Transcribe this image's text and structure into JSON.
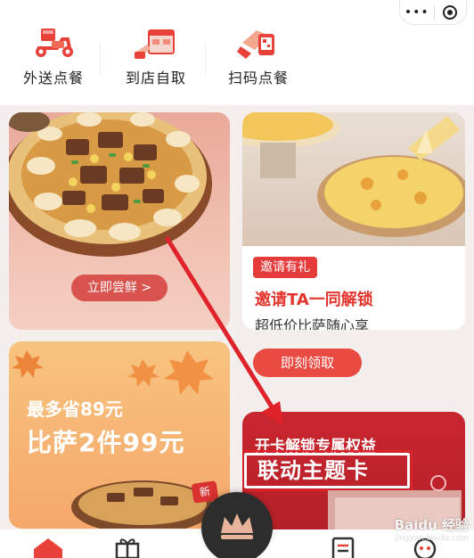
{
  "capsule": {
    "more_icon": "ellipsis-icon",
    "close_icon": "target-icon"
  },
  "services": [
    {
      "label": "外送点餐",
      "icon": "delivery-scooter-icon"
    },
    {
      "label": "到店自取",
      "icon": "store-pickup-icon"
    },
    {
      "label": "扫码点餐",
      "icon": "scan-order-icon"
    }
  ],
  "card_a": {
    "button": "立即尝鲜 >"
  },
  "card_b": {
    "tag": "邀请有礼",
    "title": "邀请TA一同解锁",
    "subtitle": "超低价比萨随心享",
    "button": "即刻领取"
  },
  "card_c": {
    "line1": "最多省89元",
    "line2": "比萨2件99元",
    "badge": "新"
  },
  "card_d": {
    "headline": "开卡解锁专属权益",
    "big": "联动主题卡"
  },
  "tabs": [
    "home-icon",
    "gift-icon",
    "crown-icon",
    "order-list-icon",
    "profile-icon"
  ],
  "watermark": {
    "line1": "Baidu 经验",
    "line2": "jingyan.baidu.com"
  },
  "colors": {
    "brand_red": "#e3352e",
    "arrow_red": "#e0232b"
  }
}
